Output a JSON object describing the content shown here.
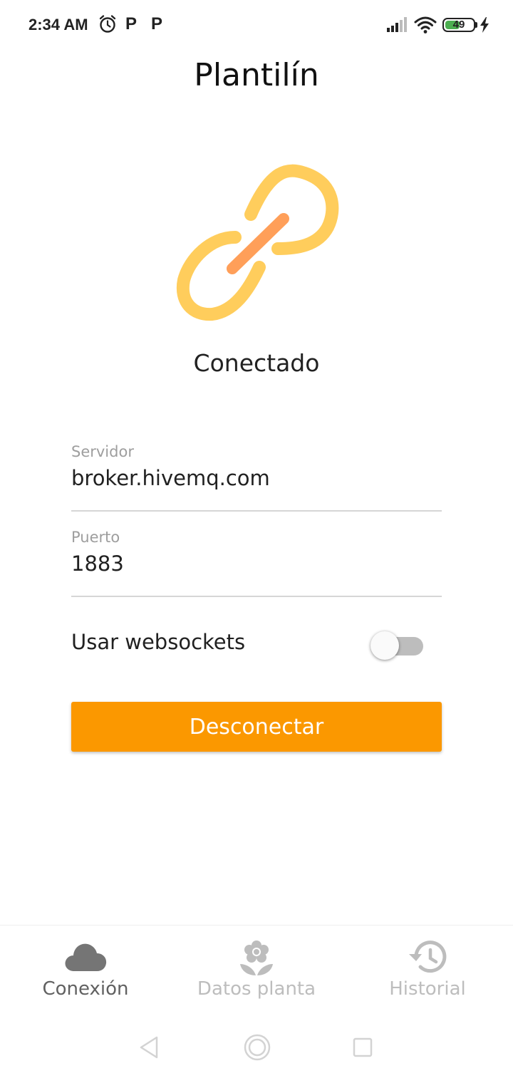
{
  "status_bar": {
    "time": "2:34 AM",
    "battery_level": "49",
    "icons": [
      "alarm-icon",
      "p-icon",
      "p-icon",
      "signal-icon",
      "wifi-icon",
      "battery-icon",
      "charging-icon"
    ]
  },
  "header": {
    "title": "Plantilín"
  },
  "connection": {
    "status": "Conectado",
    "icon": "link-icon",
    "colors": {
      "link_outer": "#ffcd5c",
      "link_inner": "#ff9f59"
    }
  },
  "form": {
    "server_label": "Servidor",
    "server_value": "broker.hivemq.com",
    "port_label": "Puerto",
    "port_value": "1883",
    "websockets_label": "Usar websockets",
    "websockets_enabled": false,
    "disconnect_label": "Desconectar",
    "accent_color": "#fb9800"
  },
  "bottom_nav": {
    "items": [
      {
        "label": "Conexión",
        "icon": "cloud-icon",
        "active": true
      },
      {
        "label": "Datos planta",
        "icon": "flower-icon",
        "active": false
      },
      {
        "label": "Historial",
        "icon": "history-icon",
        "active": false
      }
    ]
  },
  "system_nav": {
    "icons": [
      "back-icon",
      "home-icon",
      "recents-icon"
    ]
  }
}
